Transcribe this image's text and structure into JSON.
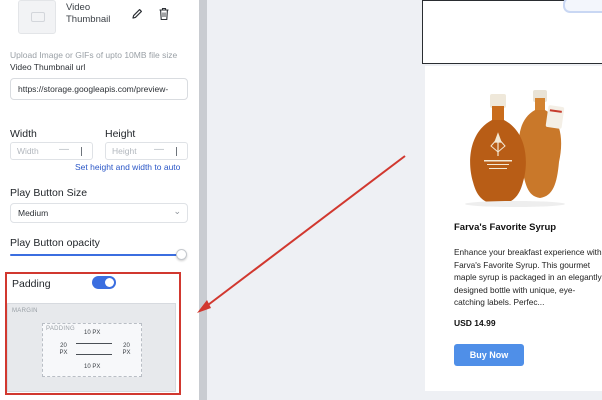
{
  "settings": {
    "thumbnail_name": "Video Thumbnail",
    "upload_hint": "Upload Image or GIFs of upto 10MB file size",
    "thumbnail_url_label": "Video Thumbnail url",
    "thumbnail_url_value": "https://storage.googleapis.com/preview-",
    "width_label": "Width",
    "width_placeholder": "Width",
    "width_minus": "—",
    "height_label": "Height",
    "height_placeholder": "Height",
    "height_minus": "—",
    "auto_link": "Set height and width to auto",
    "play_size_label": "Play Button Size",
    "play_size_value": "Medium",
    "opacity_label": "Play Button opacity",
    "opacity_value": 1.0,
    "padding_label": "Padding",
    "padding_enabled": true,
    "margin_box_label": "MARGIN",
    "padding_box_label": "PADDING",
    "padding_top": "10 PX",
    "padding_left": "20 PX",
    "padding_right": "20 PX",
    "padding_bottom": "10 PX"
  },
  "preview": {
    "product_title": "Farva's Favorite Syrup",
    "description": "Enhance your breakfast experience with Farva's Favorite Syrup. This gourmet maple syrup is packaged in an elegantly designed bottle with unique, eye-catching labels. Perfec...",
    "price": "USD 14.99",
    "buy_button": "Buy Now"
  },
  "colors": {
    "accent": "#3b6ee0",
    "highlight": "#d1382f",
    "buy_button": "#4f8fe8",
    "syrup": "#c5701e"
  },
  "icons": [
    "image-icon",
    "pencil-icon",
    "trash-icon",
    "chevron-down-icon"
  ]
}
